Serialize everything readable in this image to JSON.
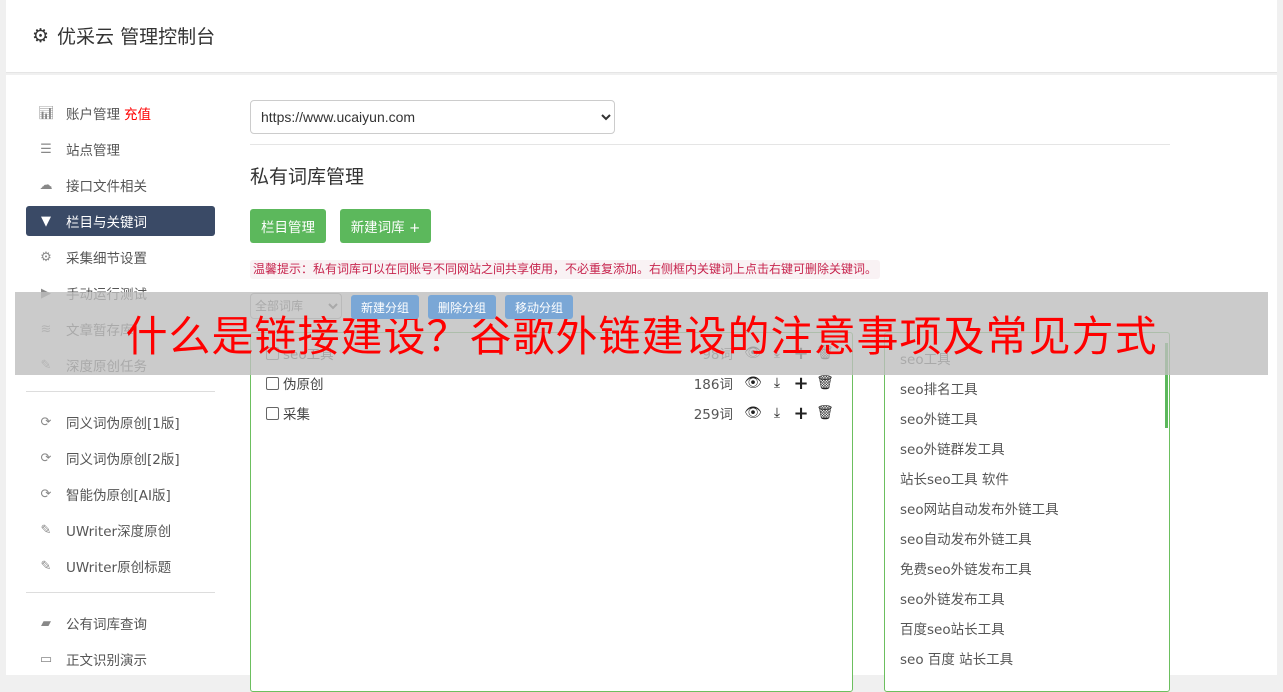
{
  "header": {
    "title": "优采云 管理控制台",
    "icon": "gear-icon"
  },
  "sidebar": {
    "groups": [
      [
        {
          "label": "账户管理",
          "extra": "充值",
          "icon": "bar-chart-icon"
        },
        {
          "label": "站点管理",
          "icon": "server-icon"
        },
        {
          "label": "接口文件相关",
          "icon": "cloud-upload-icon"
        },
        {
          "label": "栏目与关键词",
          "icon": "filter-icon",
          "active": true
        },
        {
          "label": "采集细节设置",
          "icon": "gears-icon"
        },
        {
          "label": "手动运行测试",
          "icon": "play-circle-icon"
        },
        {
          "label": "文章暂存库",
          "icon": "database-icon"
        },
        {
          "label": "深度原创任务",
          "icon": "edit-icon"
        }
      ],
      [
        {
          "label": "同义词伪原创[1版]",
          "icon": "refresh-icon"
        },
        {
          "label": "同义词伪原创[2版]",
          "icon": "refresh-icon"
        },
        {
          "label": "智能伪原创[AI版]",
          "icon": "refresh-icon"
        },
        {
          "label": "UWriter深度原创",
          "icon": "edit-icon"
        },
        {
          "label": "UWriter原创标题",
          "icon": "edit-icon"
        }
      ],
      [
        {
          "label": "公有词库查询",
          "icon": "book-icon"
        },
        {
          "label": "正文识别演示",
          "icon": "desktop-icon"
        }
      ]
    ]
  },
  "main": {
    "site_select": "https://www.ucaiyun.com",
    "heading": "私有词库管理",
    "buttons": {
      "column": "栏目管理",
      "new_lib": "新建词库 +"
    },
    "tip": "温馨提示：私有词库可以在同账号不同网站之间共享使用，不必重复添加。右侧框内关键词上点击右键可删除关键词。",
    "group_select": "全部词库",
    "group_buttons": {
      "new": "新建分组",
      "delete": "删除分组",
      "move": "移动分组"
    },
    "libraries": [
      {
        "name": "seo工具",
        "count": "98词"
      },
      {
        "name": "伪原创",
        "count": "186词"
      },
      {
        "name": "采集",
        "count": "259词"
      }
    ],
    "keywords": [
      "seo工具",
      "seo排名工具",
      "seo外链工具",
      "seo外链群发工具",
      "站长seo工具 软件",
      "seo网站自动发布外链工具",
      "seo自动发布外链工具",
      "免费seo外链发布工具",
      "seo外链发布工具",
      "百度seo站长工具",
      "seo 百度 站长工具"
    ]
  },
  "overlay": {
    "text": "什么是链接建设？谷歌外链建设的注意事项及常见方式"
  },
  "colors": {
    "green": "#5cb85c",
    "active_nav": "#3a4a66",
    "light_blue": "#7aa7d6",
    "red": "#ff0000"
  }
}
